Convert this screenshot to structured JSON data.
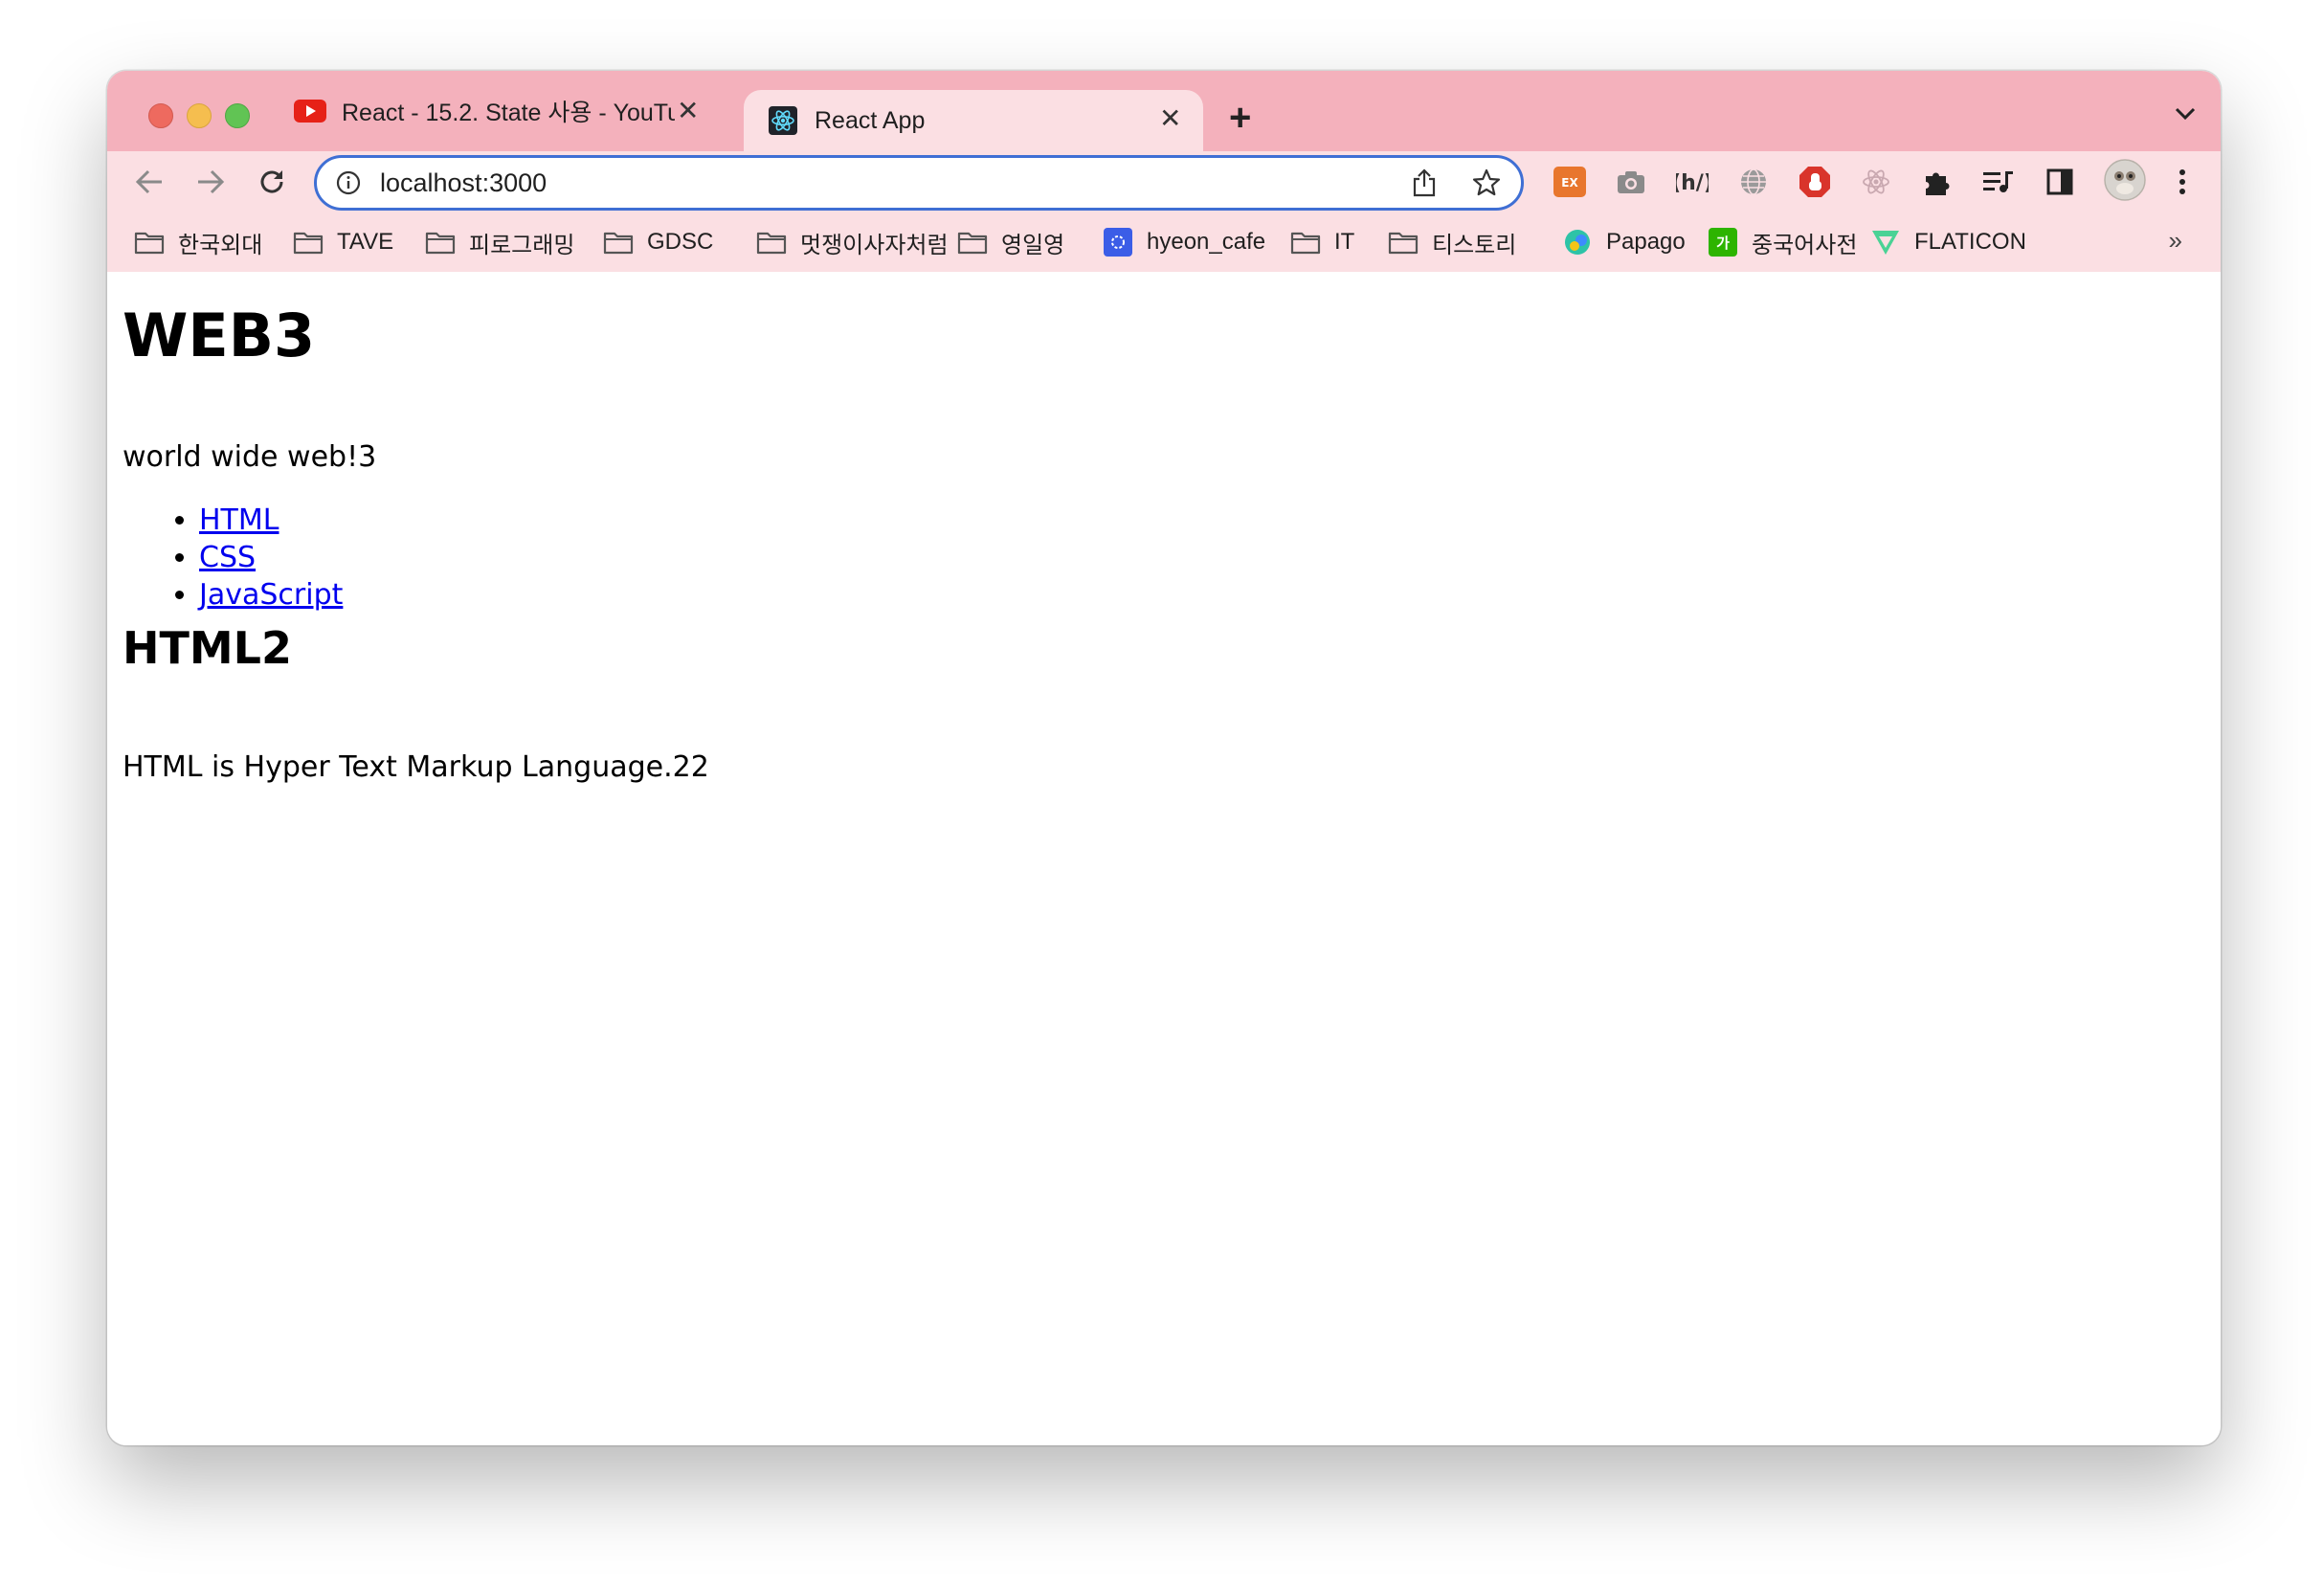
{
  "colors": {
    "tabstrip": "#f4b1bc",
    "toolbar": "#fbdfe3",
    "omnibox_border": "#3f6fd4",
    "link": "#0000ee"
  },
  "tabs": [
    {
      "title": "React - 15.2. State 사용 - YouTu",
      "favicon": "youtube-icon",
      "active": false
    },
    {
      "title": "React App",
      "favicon": "react-icon",
      "active": true
    }
  ],
  "omnibox": {
    "url": "localhost:3000"
  },
  "extensions": [
    "ex-extension-icon",
    "camera-icon",
    "wappalyzer-icon",
    "globe-icon",
    "adblock-icon",
    "react-devtools-icon",
    "puzzle-icon",
    "media-controls-icon",
    "side-panel-icon",
    "profile-avatar"
  ],
  "bookmarks": [
    {
      "label": "한국외대",
      "icon": "folder-icon"
    },
    {
      "label": "TAVE",
      "icon": "folder-icon"
    },
    {
      "label": "피로그래밍",
      "icon": "folder-icon"
    },
    {
      "label": "GDSC",
      "icon": "folder-icon"
    },
    {
      "label": "멋쟁이사자처럼",
      "icon": "folder-icon"
    },
    {
      "label": "영일영",
      "icon": "folder-icon"
    },
    {
      "label": "hyeon_cafe",
      "icon": "cafe-icon"
    },
    {
      "label": "IT",
      "icon": "folder-icon"
    },
    {
      "label": "티스토리",
      "icon": "folder-icon"
    },
    {
      "label": "Papago",
      "icon": "papago-icon"
    },
    {
      "label": "중국어사전",
      "icon": "dictionary-icon"
    },
    {
      "label": "FLATICON",
      "icon": "flaticon-icon"
    }
  ],
  "bookmarks_more": "»",
  "page": {
    "title": "WEB3",
    "subtitle": "world wide web!3",
    "nav_links": [
      "HTML",
      "CSS",
      "JavaScript"
    ],
    "article_title": "HTML2",
    "article_body": "HTML is Hyper Text Markup Language.22"
  }
}
